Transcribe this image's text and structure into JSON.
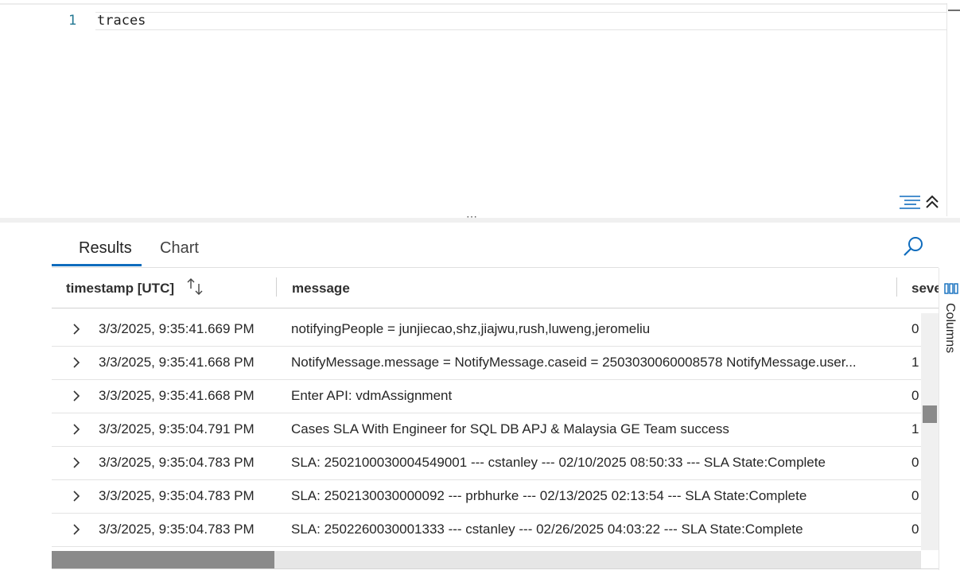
{
  "editor": {
    "line_number": "1",
    "query": "traces"
  },
  "results": {
    "tabs": [
      {
        "label": "Results",
        "active": true
      },
      {
        "label": "Chart",
        "active": false
      }
    ],
    "columns": {
      "timestamp": "timestamp [UTC]",
      "message": "message",
      "severity": "seve"
    },
    "rows": [
      {
        "timestamp": "3/3/2025, 9:35:41.669 PM",
        "message": "notifyingPeople = junjiecao,shz,jiajwu,rush,luweng,jeromeliu",
        "severity": "0"
      },
      {
        "timestamp": "3/3/2025, 9:35:41.668 PM",
        "message": "NotifyMessage.message = NotifyMessage.caseid = 2503030060008578 NotifyMessage.user...",
        "severity": "1"
      },
      {
        "timestamp": "3/3/2025, 9:35:41.668 PM",
        "message": "Enter API: vdmAssignment",
        "severity": "0"
      },
      {
        "timestamp": "3/3/2025, 9:35:04.791 PM",
        "message": "Cases SLA With Engineer for SQL DB APJ & Malaysia GE Team success",
        "severity": "1"
      },
      {
        "timestamp": "3/3/2025, 9:35:04.783 PM",
        "message": "SLA: 2502100030004549001 --- cstanley --- 02/10/2025 08:50:33 --- SLA State:Complete",
        "severity": "0"
      },
      {
        "timestamp": "3/3/2025, 9:35:04.783 PM",
        "message": "SLA: 2502130030000092 --- prbhurke --- 02/13/2025 02:13:54 --- SLA State:Complete",
        "severity": "0"
      },
      {
        "timestamp": "3/3/2025, 9:35:04.783 PM",
        "message": "SLA: 2502260030001333 --- cstanley --- 02/26/2025 04:03:22 --- SLA State:Complete",
        "severity": "0"
      }
    ],
    "columns_panel_label": "Columns"
  },
  "colors": {
    "accent": "#0f6cbd",
    "line_number": "#237893"
  },
  "icons": [
    "format-icon",
    "collapse-up-icon",
    "search-icon",
    "sort-icon",
    "chevron-right-icon",
    "columns-icon"
  ]
}
